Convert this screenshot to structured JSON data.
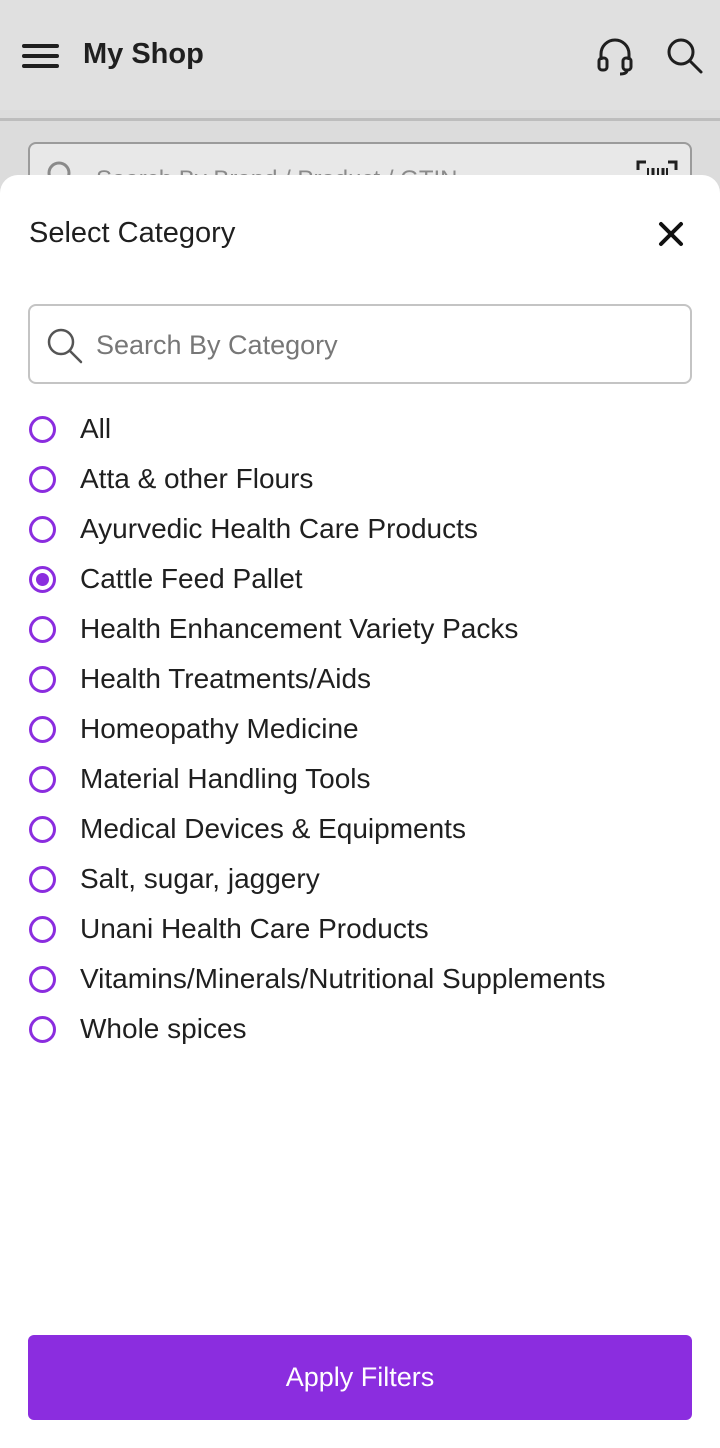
{
  "appbar": {
    "title": "My Shop",
    "icons": {
      "menu": "hamburger-menu-icon",
      "support": "headset-icon",
      "search": "search-icon"
    }
  },
  "background_search": {
    "placeholder": "Search By Brand / Product / GTIN",
    "barcode_icon": "barcode-scan-icon"
  },
  "sheet": {
    "title": "Select Category",
    "close_icon": "close-icon",
    "search": {
      "placeholder": "Search By Category",
      "value": ""
    },
    "options": [
      {
        "label": "All",
        "selected": false
      },
      {
        "label": "Atta & other Flours",
        "selected": false
      },
      {
        "label": "Ayurvedic Health Care Products",
        "selected": false
      },
      {
        "label": "Cattle Feed Pallet",
        "selected": true
      },
      {
        "label": "Health Enhancement Variety Packs",
        "selected": false
      },
      {
        "label": "Health Treatments/Aids",
        "selected": false
      },
      {
        "label": "Homeopathy Medicine",
        "selected": false
      },
      {
        "label": "Material Handling Tools",
        "selected": false
      },
      {
        "label": "Medical Devices & Equipments",
        "selected": false
      },
      {
        "label": "Salt, sugar, jaggery",
        "selected": false
      },
      {
        "label": "Unani Health Care Products",
        "selected": false
      },
      {
        "label": "Vitamins/Minerals/Nutritional Supplements",
        "selected": false
      },
      {
        "label": "Whole spices",
        "selected": false
      }
    ],
    "apply_label": "Apply Filters"
  },
  "colors": {
    "accent": "#8b2ddf",
    "text": "#1f1f1f",
    "overlay_background": "#dcdcdc",
    "sheet_background": "#ffffff"
  }
}
